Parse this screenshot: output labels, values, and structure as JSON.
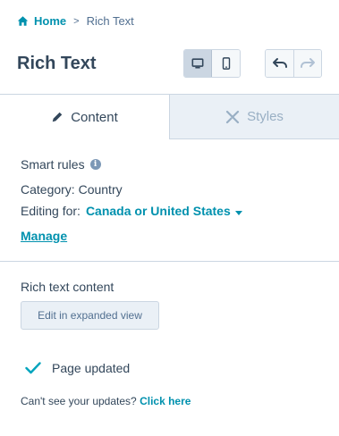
{
  "breadcrumb": {
    "home": "Home",
    "separator": ">",
    "current": "Rich Text"
  },
  "header": {
    "title": "Rich Text"
  },
  "toolbar": {
    "desktop_icon": "desktop-icon",
    "mobile_icon": "mobile-icon",
    "undo_icon": "undo-icon",
    "redo_icon": "redo-icon"
  },
  "tabs": [
    {
      "label": "Content",
      "icon": "pencil-icon",
      "active": true
    },
    {
      "label": "Styles",
      "icon": "tools-icon",
      "active": false
    }
  ],
  "smart_rules": {
    "label": "Smart rules",
    "category_label": "Category: Country",
    "editing_label": "Editing for:",
    "editing_value": "Canada or United States",
    "manage": "Manage"
  },
  "rich_text": {
    "label": "Rich text content",
    "edit_button": "Edit in expanded view"
  },
  "status": {
    "updated": "Page updated",
    "cant_see_prefix": "Can't see your updates?",
    "cant_see_link": "Click here"
  },
  "colors": {
    "accent": "#0091ae",
    "text": "#33475b",
    "border": "#cbd6e2",
    "tab_inactive_bg": "#eaf0f6",
    "check": "#00a4bd"
  }
}
